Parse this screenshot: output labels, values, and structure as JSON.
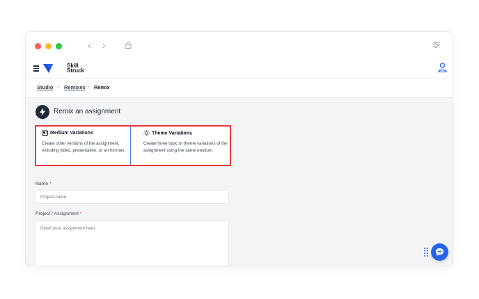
{
  "app": {
    "brand_line1": "Skill",
    "brand_line2": "Struck"
  },
  "breadcrumb": [
    {
      "label": "Studio"
    },
    {
      "label": "Remixes"
    },
    {
      "label": "Remix"
    }
  ],
  "page": {
    "title": "Remix an assignment"
  },
  "options": [
    {
      "title": "Medium Variations",
      "description": "Create other versions of the assignment, including video, presentation, or art formats",
      "icon": "media-icon"
    },
    {
      "title": "Theme Variations",
      "description": "Create three topic or theme variations of the assignment using the same medium",
      "icon": "lightbulb-icon"
    }
  ],
  "form": {
    "name_label": "Name",
    "name_placeholder": "Project name",
    "project_label": "Project / Assignment",
    "project_placeholder": "Detail your assignment here",
    "required_mark": "*"
  },
  "colors": {
    "accent": "#2563eb",
    "highlight": "#e53935"
  }
}
